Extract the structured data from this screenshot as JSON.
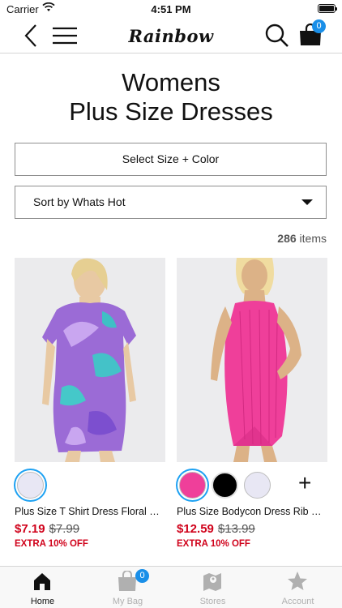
{
  "status_bar": {
    "carrier": "Carrier",
    "time": "4:51 PM"
  },
  "nav": {
    "logo_text": "Rainbow",
    "bag_count": "0"
  },
  "page_title": {
    "line1": "Womens",
    "line2": "Plus Size Dresses"
  },
  "filters": {
    "select_size_label": "Select Size + Color",
    "sort_label": "Sort by Whats Hot"
  },
  "results": {
    "count": "286",
    "count_suffix": "items"
  },
  "products": [
    {
      "name": "Plus Size T Shirt Dress Floral Ne…",
      "sale_price": "$7.19",
      "original_price": "$7.99",
      "promo": "EXTRA 10% OFF",
      "swatches": [
        "#e8e7f4"
      ],
      "more_label": ""
    },
    {
      "name": "Plus Size Bodycon Dress Rib Knit…",
      "sale_price": "$12.59",
      "original_price": "$13.99",
      "promo": "EXTRA 10% OFF",
      "swatches": [
        "#ef3f9a",
        "#000000",
        "#e8e7f4"
      ],
      "more_label": "+"
    }
  ],
  "tab_bar": {
    "home": "Home",
    "my_bag": "My Bag",
    "my_bag_count": "0",
    "stores": "Stores",
    "account": "Account"
  },
  "colors": {
    "accent_blue": "#1a8fe8",
    "sale_red": "#d0021b",
    "dress_pink": "#ef3f9a"
  }
}
